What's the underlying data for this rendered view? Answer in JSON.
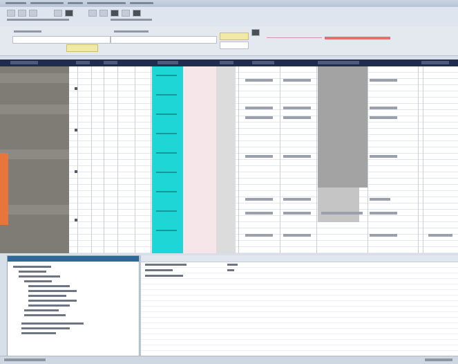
{
  "window": {
    "title": "",
    "accent_color": "#1f2c4e",
    "highlight_column_color": "#1fd6d6",
    "error_color": "#e05a5a",
    "side_marker_color": "#e8763a"
  },
  "toolbar": {
    "buttons": [
      "back",
      "forward",
      "refresh",
      "save",
      "print",
      "find",
      "filter",
      "settings"
    ]
  },
  "filter": {
    "status_message": ""
  },
  "grid": {
    "row_count": 30,
    "column_count": 16
  },
  "left_panel": {
    "title": ""
  },
  "right_panel": {
    "title": ""
  },
  "statusbar": {
    "left_text": "",
    "right_text": ""
  }
}
